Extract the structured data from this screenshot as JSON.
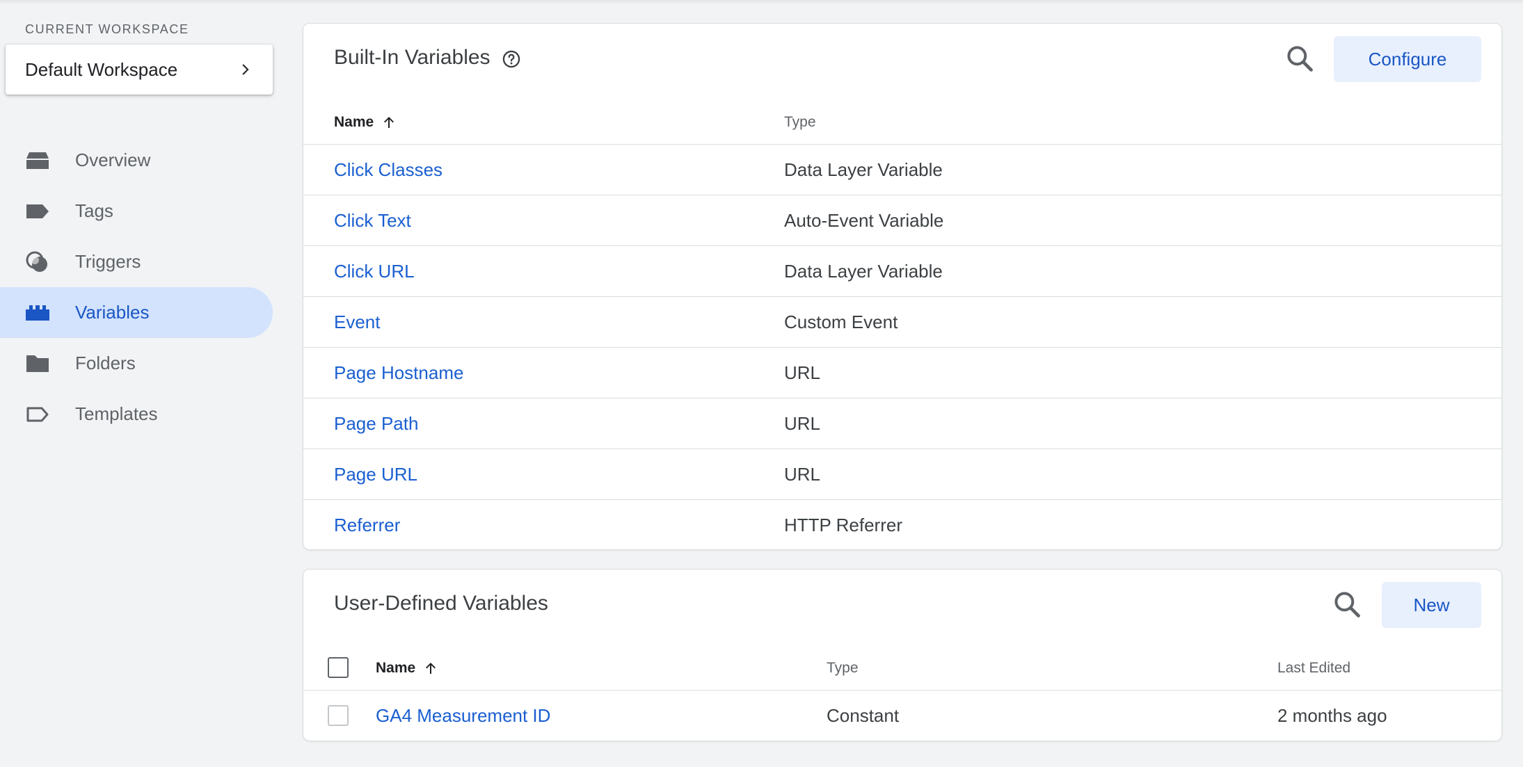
{
  "sidebar": {
    "workspace_label": "CURRENT WORKSPACE",
    "workspace_name": "Default Workspace",
    "nav": [
      {
        "label": "Overview",
        "icon": "overview-icon"
      },
      {
        "label": "Tags",
        "icon": "tag-icon"
      },
      {
        "label": "Triggers",
        "icon": "trigger-icon"
      },
      {
        "label": "Variables",
        "icon": "variables-icon",
        "active": true
      },
      {
        "label": "Folders",
        "icon": "folder-icon"
      },
      {
        "label": "Templates",
        "icon": "template-icon"
      }
    ]
  },
  "builtin": {
    "title": "Built-In Variables",
    "configure_label": "Configure",
    "columns": {
      "name": "Name",
      "type": "Type"
    },
    "rows": [
      {
        "name": "Click Classes",
        "type": "Data Layer Variable"
      },
      {
        "name": "Click Text",
        "type": "Auto-Event Variable"
      },
      {
        "name": "Click URL",
        "type": "Data Layer Variable"
      },
      {
        "name": "Event",
        "type": "Custom Event"
      },
      {
        "name": "Page Hostname",
        "type": "URL"
      },
      {
        "name": "Page Path",
        "type": "URL"
      },
      {
        "name": "Page URL",
        "type": "URL"
      },
      {
        "name": "Referrer",
        "type": "HTTP Referrer"
      }
    ]
  },
  "user_defined": {
    "title": "User-Defined Variables",
    "new_label": "New",
    "columns": {
      "name": "Name",
      "type": "Type",
      "last_edited": "Last Edited"
    },
    "rows": [
      {
        "name": "GA4 Measurement ID",
        "type": "Constant",
        "last_edited": "2 months ago"
      }
    ]
  },
  "colors": {
    "accent": "#1a56c4",
    "link": "#1a5fd1",
    "active_nav_bg": "#d3e3fd",
    "button_bg": "#e8f0fe"
  }
}
